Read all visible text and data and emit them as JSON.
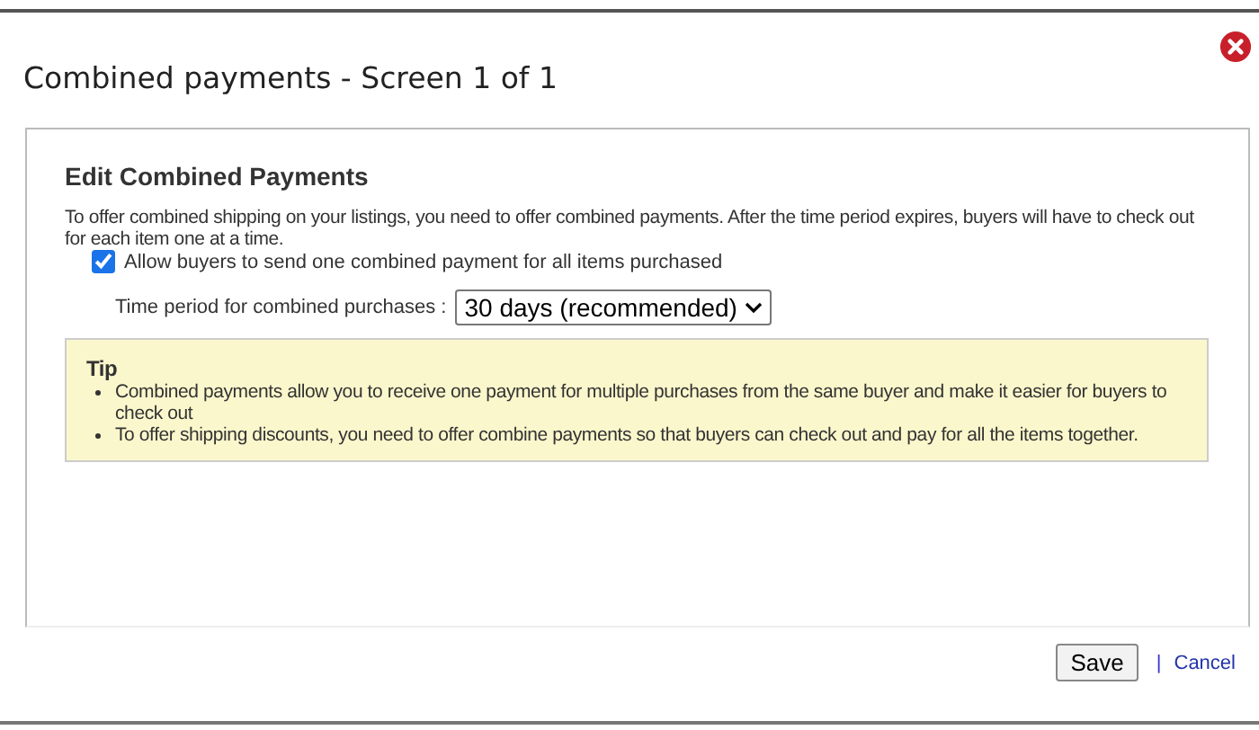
{
  "dialog": {
    "title": "Combined payments - Screen 1 of 1"
  },
  "section": {
    "heading": "Edit Combined Payments",
    "intro": "To offer combined shipping on your listings, you need to offer combined payments. After the time period expires, buyers will have to check out for each item one at a time.",
    "checkbox": {
      "label": "Allow buyers to send one combined payment for all items purchased",
      "checked": true
    },
    "time_period": {
      "label": "Time period for combined purchases :",
      "value": "30 days (recommended)"
    },
    "tip": {
      "title": "Tip",
      "items": [
        "Combined payments allow you to receive one payment for multiple purchases from the same buyer and make it easier for buyers to check out",
        "To offer shipping discounts, you need to offer combine payments so that buyers can check out and pay for all the items together."
      ]
    }
  },
  "buttons": {
    "save": "Save",
    "separator": "|",
    "cancel": "Cancel"
  }
}
